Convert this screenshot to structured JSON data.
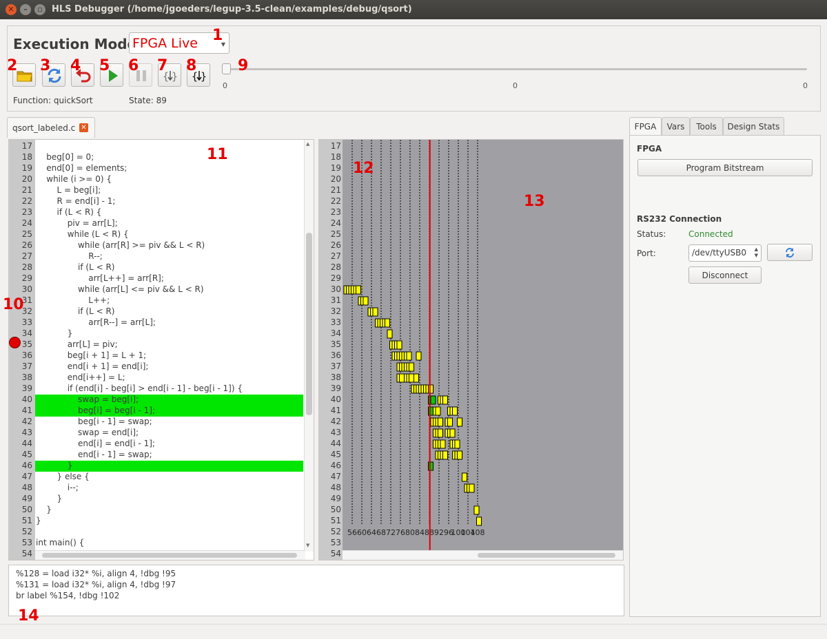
{
  "window": {
    "title": "HLS Debugger (/home/jgoeders/legup-3.5-clean/examples/debug/qsort)"
  },
  "toolbar": {
    "execution_mode_label": "Execution Mode",
    "execution_mode_value": "FPGA Live",
    "function_label": "Function: quickSort",
    "state_label": "State: 89",
    "slider": {
      "min_label": "0",
      "mid_label": "0",
      "max_label": "0",
      "value": 0
    }
  },
  "annotations": [
    "1",
    "2",
    "3",
    "4",
    "5",
    "6",
    "7",
    "8",
    "9",
    "10",
    "11",
    "12",
    "13",
    "14"
  ],
  "editor": {
    "tab_label": "qsort_labeled.c",
    "breakpoint_line": 35,
    "highlighted_lines": [
      40,
      41,
      46
    ],
    "lines": [
      {
        "n": "17",
        "text": ""
      },
      {
        "n": "18",
        "text": "    beg[0] = 0;"
      },
      {
        "n": "19",
        "text": "    end[0] = elements;"
      },
      {
        "n": "20",
        "text": "    while (i >= 0) {"
      },
      {
        "n": "21",
        "text": "        L = beg[i];"
      },
      {
        "n": "22",
        "text": "        R = end[i] - 1;"
      },
      {
        "n": "23",
        "text": "        if (L < R) {"
      },
      {
        "n": "24",
        "text": "            piv = arr[L];"
      },
      {
        "n": "25",
        "text": "            while (L < R) {"
      },
      {
        "n": "26",
        "text": "                while (arr[R] >= piv && L < R)"
      },
      {
        "n": "27",
        "text": "                    R--;"
      },
      {
        "n": "28",
        "text": "                if (L < R)"
      },
      {
        "n": "29",
        "text": "                    arr[L++] = arr[R];"
      },
      {
        "n": "30",
        "text": "                while (arr[L] <= piv && L < R)"
      },
      {
        "n": "31",
        "text": "                    L++;"
      },
      {
        "n": "32",
        "text": "                if (L < R)"
      },
      {
        "n": "33",
        "text": "                    arr[R--] = arr[L];"
      },
      {
        "n": "34",
        "text": "            }"
      },
      {
        "n": "35",
        "text": "            arr[L] = piv;"
      },
      {
        "n": "36",
        "text": "            beg[i + 1] = L + 1;"
      },
      {
        "n": "37",
        "text": "            end[i + 1] = end[i];"
      },
      {
        "n": "38",
        "text": "            end[i++] = L;"
      },
      {
        "n": "39",
        "text": "            if (end[i] - beg[i] > end[i - 1] - beg[i - 1]) {"
      },
      {
        "n": "40",
        "text": "                swap = beg[i];"
      },
      {
        "n": "41",
        "text": "                beg[i] = beg[i - 1];"
      },
      {
        "n": "42",
        "text": "                beg[i - 1] = swap;"
      },
      {
        "n": "43",
        "text": "                swap = end[i];"
      },
      {
        "n": "44",
        "text": "                end[i] = end[i - 1];"
      },
      {
        "n": "45",
        "text": "                end[i - 1] = swap;"
      },
      {
        "n": "46",
        "text": "            }"
      },
      {
        "n": "47",
        "text": "        } else {"
      },
      {
        "n": "48",
        "text": "            i--;"
      },
      {
        "n": "49",
        "text": "        }"
      },
      {
        "n": "50",
        "text": "    }"
      },
      {
        "n": "51",
        "text": "}"
      },
      {
        "n": "52",
        "text": ""
      },
      {
        "n": "53",
        "text": "int main() {"
      },
      {
        "n": "54",
        "text": ""
      }
    ]
  },
  "schedule": {
    "current_cycle": 89,
    "x_ticks": [
      "56",
      "60",
      "64",
      "68",
      "72",
      "76",
      "80",
      "84",
      "88",
      "92",
      "96",
      "100",
      "104",
      "108"
    ],
    "line_numbers": [
      "17",
      "18",
      "19",
      "20",
      "21",
      "22",
      "23",
      "24",
      "25",
      "26",
      "27",
      "28",
      "29",
      "30",
      "31",
      "32",
      "33",
      "34",
      "35",
      "36",
      "37",
      "38",
      "39",
      "40",
      "41",
      "42",
      "43",
      "44",
      "45",
      "46",
      "47",
      "48",
      "49",
      "50",
      "51",
      "52",
      "53",
      "54"
    ],
    "executed_color": "#ffff00",
    "current_color": "#00cc00",
    "marker_color": "#e60000",
    "blocks": [
      {
        "line": 30,
        "cycles": [
          54,
          55,
          56,
          57,
          58,
          59
        ]
      },
      {
        "line": 31,
        "cycles": [
          60,
          61,
          62
        ]
      },
      {
        "line": 32,
        "cycles": [
          64,
          65,
          66
        ]
      },
      {
        "line": 33,
        "cycles": [
          67,
          68,
          69,
          70,
          71
        ]
      },
      {
        "line": 34,
        "cycles": [
          72
        ]
      },
      {
        "line": 35,
        "cycles": [
          73,
          74,
          75,
          76
        ]
      },
      {
        "line": 36,
        "cycles": [
          74,
          75,
          76,
          77,
          78,
          79,
          80,
          84
        ]
      },
      {
        "line": 37,
        "cycles": [
          76,
          77,
          78,
          79,
          80,
          81
        ]
      },
      {
        "line": 38,
        "cycles": [
          76,
          77,
          79,
          80,
          81,
          83
        ]
      },
      {
        "line": 39,
        "cycles": [
          82,
          83,
          84,
          85,
          86,
          87,
          88,
          89
        ]
      },
      {
        "line": 40,
        "cycles": [
          89,
          90,
          93,
          94,
          95
        ]
      },
      {
        "line": 41,
        "cycles": [
          89,
          90,
          91,
          92,
          97,
          98,
          99
        ]
      },
      {
        "line": 42,
        "cycles": [
          90,
          91,
          92,
          93,
          96,
          97,
          101
        ]
      },
      {
        "line": 43,
        "cycles": [
          91,
          92,
          93,
          96,
          97,
          98
        ]
      },
      {
        "line": 44,
        "cycles": [
          91,
          92,
          93,
          94,
          98,
          99,
          100
        ]
      },
      {
        "line": 45,
        "cycles": [
          92,
          93,
          94,
          95,
          99,
          100,
          101
        ]
      },
      {
        "line": 46,
        "cycles": [
          89
        ]
      },
      {
        "line": 47,
        "cycles": [
          103
        ]
      },
      {
        "line": 48,
        "cycles": [
          104,
          105,
          106
        ]
      },
      {
        "line": 50,
        "cycles": [
          108
        ]
      },
      {
        "line": 51,
        "cycles": [
          109
        ]
      }
    ],
    "current_blocks": [
      {
        "line": 40,
        "cycles": [
          89,
          90
        ]
      },
      {
        "line": 41,
        "cycles": [
          89
        ]
      },
      {
        "line": 46,
        "cycles": [
          89
        ]
      }
    ]
  },
  "ir": {
    "lines": [
      "%128 = load i32* %i, align 4, !dbg !95",
      "%131 = load i32* %i, align 4, !dbg !97",
      "br label %154, !dbg !102"
    ]
  },
  "right_tabs": [
    "FPGA",
    "Vars",
    "Tools",
    "Design Stats"
  ],
  "fpga": {
    "section_title": "FPGA",
    "program_button": "Program Bitstream",
    "rs232_title": "RS232 Connection",
    "status_label": "Status:",
    "status_value": "Connected",
    "status_color": "#2e8b2e",
    "port_label": "Port:",
    "port_value": "/dev/ttyUSB0",
    "disconnect_button": "Disconnect"
  }
}
